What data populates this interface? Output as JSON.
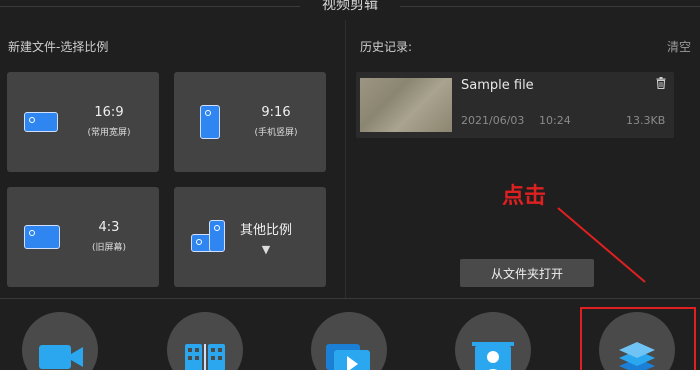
{
  "window": {
    "title": "视频剪辑"
  },
  "new_file": {
    "label": "新建文件-选择比例",
    "ratios": [
      {
        "ratio": "16:9",
        "desc": "(常用宽屏)"
      },
      {
        "ratio": "9:16",
        "desc": "(手机竖屏)"
      },
      {
        "ratio": "4:3",
        "desc": "(旧屏幕)"
      },
      {
        "ratio": "其他比例",
        "desc": "▼"
      }
    ]
  },
  "history": {
    "label": "历史记录:",
    "clear_label": "清空",
    "items": [
      {
        "name": "Sample file",
        "date": "2021/06/03",
        "time": "10:24",
        "size": "13.3KB"
      }
    ],
    "open_folder_label": "从文件夹打开"
  },
  "annotation": {
    "text": "点击"
  },
  "colors": {
    "accent": "#2f86f0",
    "annotation": "#e02020",
    "background": "#1f1f1f",
    "tile": "#434343"
  },
  "toolbar": {
    "icons": [
      "video-camera-icon",
      "film-strip-icon",
      "video-play-icon",
      "person-image-icon",
      "layers-icon"
    ]
  }
}
